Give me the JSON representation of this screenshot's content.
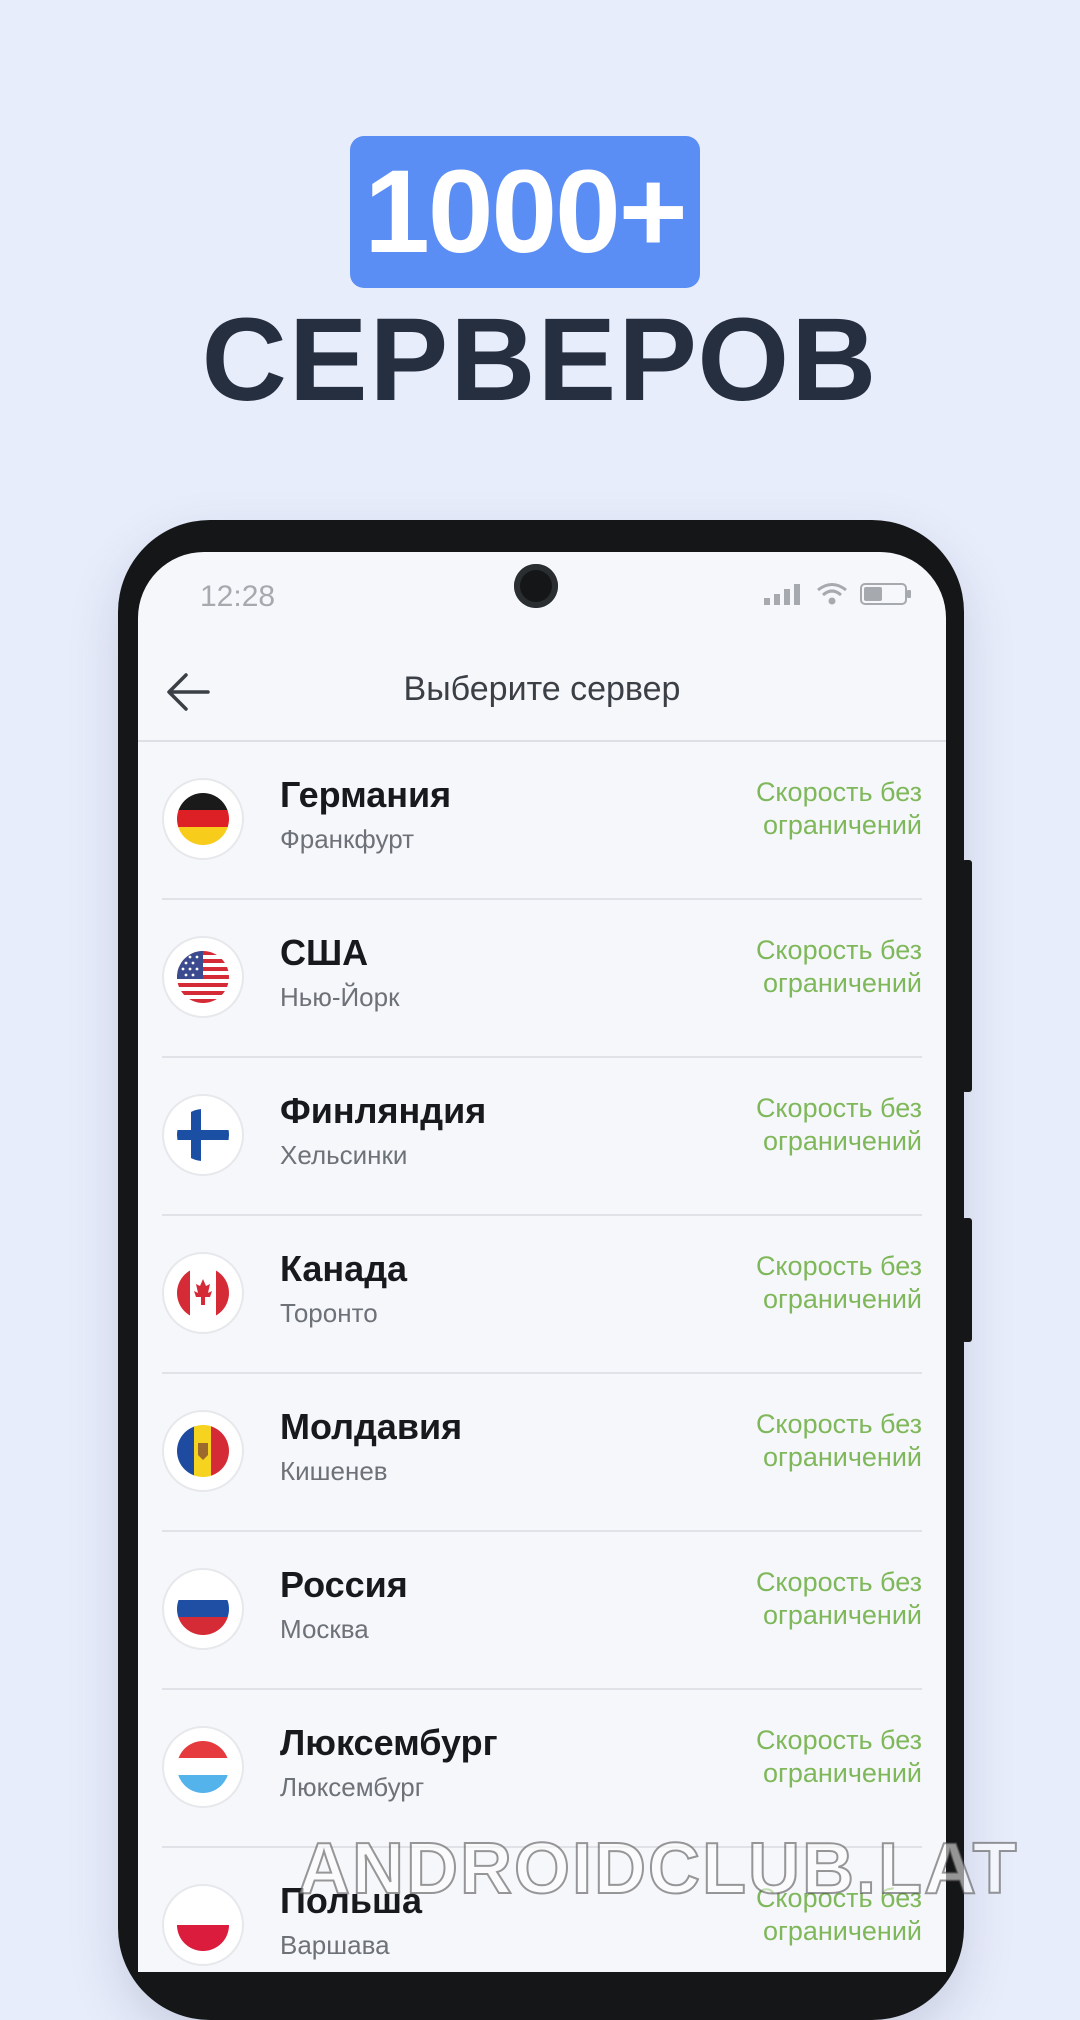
{
  "promo": {
    "count": "1000+",
    "title": "СЕРВЕРОВ"
  },
  "status_bar": {
    "time": "12:28"
  },
  "header": {
    "title": "Выберите сервер"
  },
  "servers": [
    {
      "country": "Германия",
      "city": "Франкфурт",
      "speed": "Скорость без ограничений",
      "flag": "germany-flag-icon"
    },
    {
      "country": "США",
      "city": "Нью-Йорк",
      "speed": "Скорость без ограничений",
      "flag": "usa-flag-icon"
    },
    {
      "country": "Финляндия",
      "city": "Хельсинки",
      "speed": "Скорость без ограничений",
      "flag": "finland-flag-icon"
    },
    {
      "country": "Канада",
      "city": "Торонто",
      "speed": "Скорость без ограничений",
      "flag": "canada-flag-icon"
    },
    {
      "country": "Молдавия",
      "city": "Кишенев",
      "speed": "Скорость без ограничений",
      "flag": "moldova-flag-icon"
    },
    {
      "country": "Россия",
      "city": "Москва",
      "speed": "Скорость без ограничений",
      "flag": "russia-flag-icon"
    },
    {
      "country": "Люксембург",
      "city": "Люксембург",
      "speed": "Скорость без ограничений",
      "flag": "luxembourg-flag-icon"
    },
    {
      "country": "Польша",
      "city": "Варшава",
      "speed": "Скорость без ограничений",
      "flag": "poland-flag-icon"
    }
  ],
  "watermark": "ANDROIDCLUB.LAT",
  "colors": {
    "accent": "#5b8ef5",
    "speed_text": "#7fb85a",
    "background": "#e8edfb"
  }
}
